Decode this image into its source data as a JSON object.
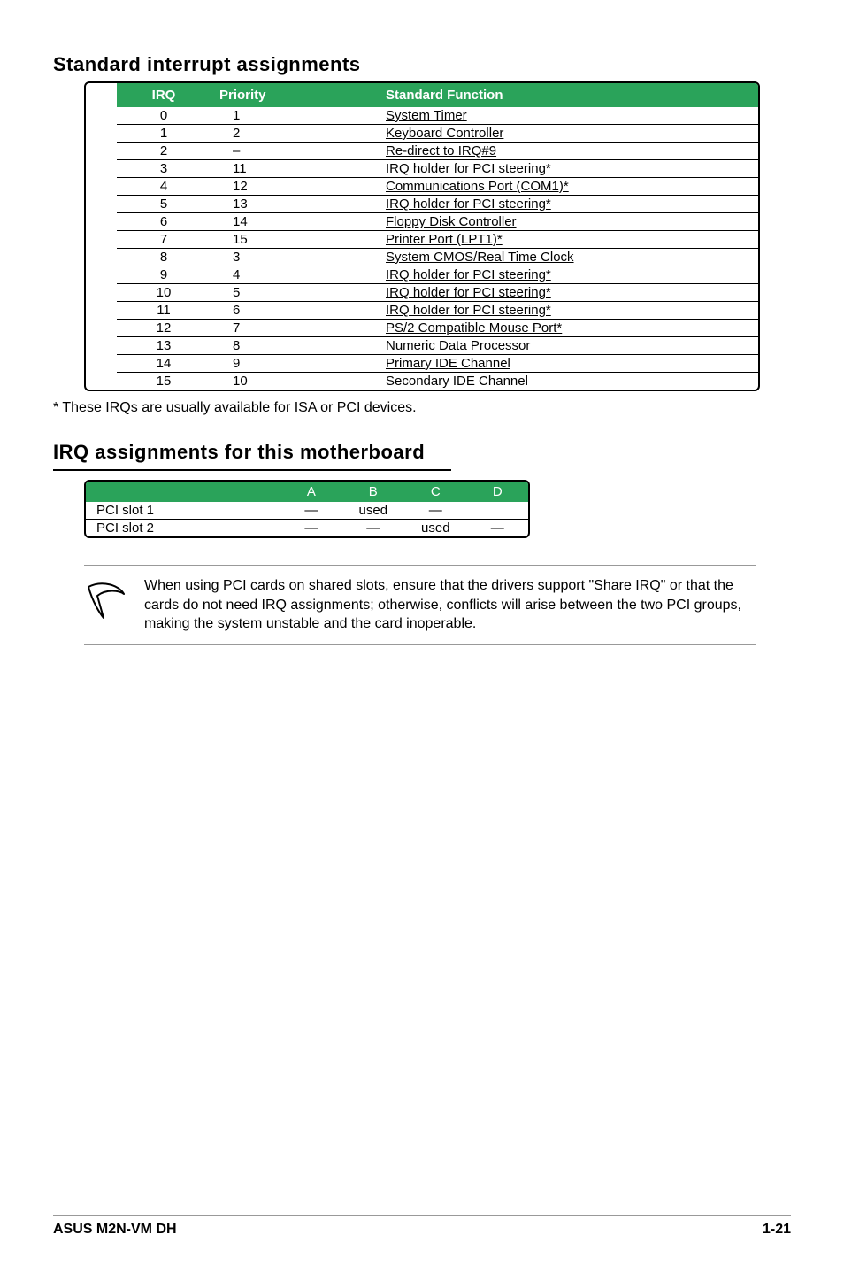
{
  "section1": {
    "title": "Standard interrupt assignments",
    "headers": {
      "irq": "IRQ",
      "priority": "Priority",
      "fn": "Standard Function"
    },
    "rows": [
      {
        "irq": "0",
        "pri": "1",
        "fn": "System Timer"
      },
      {
        "irq": "1",
        "pri": "2",
        "fn": "Keyboard Controller"
      },
      {
        "irq": "2",
        "pri": "–",
        "fn": "Re-direct to IRQ#9"
      },
      {
        "irq": "3",
        "pri": "11",
        "fn": "IRQ holder for PCI steering*"
      },
      {
        "irq": "4",
        "pri": "12",
        "fn": "Communications Port (COM1)*"
      },
      {
        "irq": "5",
        "pri": "13",
        "fn": "IRQ holder for PCI steering*"
      },
      {
        "irq": "6",
        "pri": "14",
        "fn": "Floppy Disk Controller"
      },
      {
        "irq": "7",
        "pri": "15",
        "fn": "Printer Port (LPT1)*"
      },
      {
        "irq": "8",
        "pri": "3",
        "fn": "System CMOS/Real Time Clock"
      },
      {
        "irq": "9",
        "pri": "4",
        "fn": "IRQ holder for PCI steering*"
      },
      {
        "irq": "10",
        "pri": "5",
        "fn": "IRQ holder for PCI steering*"
      },
      {
        "irq": "11",
        "pri": "6",
        "fn": "IRQ holder for PCI steering*"
      },
      {
        "irq": "12",
        "pri": "7",
        "fn": "PS/2 Compatible Mouse Port*"
      },
      {
        "irq": "13",
        "pri": "8",
        "fn": "Numeric Data Processor"
      },
      {
        "irq": "14",
        "pri": "9",
        "fn": "Primary IDE Channel"
      },
      {
        "irq": "15",
        "pri": "10",
        "fn": "Secondary IDE Channel"
      }
    ],
    "footnote": "* These IRQs are usually available for ISA or PCI devices."
  },
  "section2": {
    "title": "IRQ assignments for this motherboard",
    "headers": {
      "a": "A",
      "b": "B",
      "c": "C",
      "d": "D"
    },
    "rows": [
      {
        "label": "PCI slot 1",
        "a": "—",
        "b": "used",
        "c": "—",
        "d": ""
      },
      {
        "label": "PCI slot 2",
        "a": "—",
        "b": "—",
        "c": "used",
        "d": "—"
      }
    ]
  },
  "callout": "When using PCI cards on shared slots, ensure that the drivers support \"Share IRQ\" or that the cards do not need IRQ assignments; otherwise, conflicts will arise between the two PCI groups, making the system unstable and the card inoperable.",
  "footer": {
    "left": "ASUS M2N-VM DH",
    "right": "1-21"
  },
  "chart_data": {
    "type": "table",
    "title": "Standard interrupt assignments",
    "columns": [
      "IRQ",
      "Priority",
      "Standard Function"
    ],
    "rows": [
      [
        0,
        1,
        "System Timer"
      ],
      [
        1,
        2,
        "Keyboard Controller"
      ],
      [
        2,
        null,
        "Re-direct to IRQ#9"
      ],
      [
        3,
        11,
        "IRQ holder for PCI steering*"
      ],
      [
        4,
        12,
        "Communications Port (COM1)*"
      ],
      [
        5,
        13,
        "IRQ holder for PCI steering*"
      ],
      [
        6,
        14,
        "Floppy Disk Controller"
      ],
      [
        7,
        15,
        "Printer Port (LPT1)*"
      ],
      [
        8,
        3,
        "System CMOS/Real Time Clock"
      ],
      [
        9,
        4,
        "IRQ holder for PCI steering*"
      ],
      [
        10,
        5,
        "IRQ holder for PCI steering*"
      ],
      [
        11,
        6,
        "IRQ holder for PCI steering*"
      ],
      [
        12,
        7,
        "PS/2 Compatible Mouse Port*"
      ],
      [
        13,
        8,
        "Numeric Data Processor"
      ],
      [
        14,
        9,
        "Primary IDE Channel"
      ],
      [
        15,
        10,
        "Secondary IDE Channel"
      ]
    ]
  }
}
